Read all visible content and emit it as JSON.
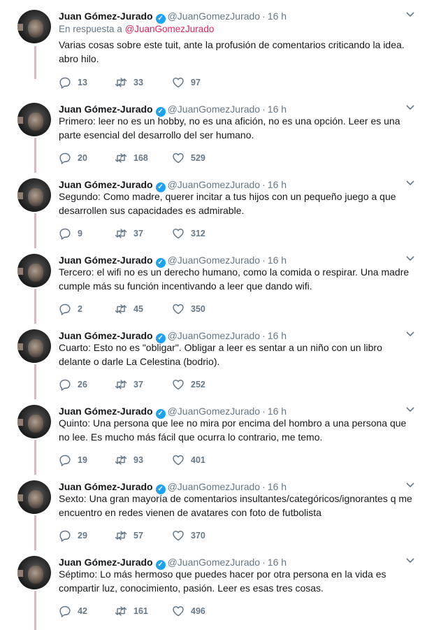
{
  "tweets": [
    {
      "name": "Juan Gómez-Jurado",
      "handle": "@JuanGomezJurado",
      "time": "16 h",
      "reply_prefix": "En respuesta a ",
      "reply_mention": "@JuanGomezJurado",
      "text": "Varias cosas sobre este tuit, ante la profusión de comentarios criticando la idea. abro hilo.",
      "replies": "13",
      "retweets": "33",
      "likes": "97"
    },
    {
      "name": "Juan Gómez-Jurado",
      "handle": "@JuanGomezJurado",
      "time": "16 h",
      "text": "Primero: leer no es un hobby, no es una afición, no es una opción. Leer es una parte esencial del desarrollo del ser humano.",
      "replies": "20",
      "retweets": "168",
      "likes": "529"
    },
    {
      "name": "Juan Gómez-Jurado",
      "handle": "@JuanGomezJurado",
      "time": "16 h",
      "text": "Segundo: Como madre, querer incitar a tus hijos con un pequeño juego a que desarrollen sus capacidades es admirable.",
      "replies": "9",
      "retweets": "37",
      "likes": "312"
    },
    {
      "name": "Juan Gómez-Jurado",
      "handle": "@JuanGomezJurado",
      "time": "16 h",
      "text": "Tercero: el wifi no es un derecho humano, como la comida o respirar. Una madre cumple más su función incentivando a leer que dando wifi.",
      "replies": "2",
      "retweets": "45",
      "likes": "350"
    },
    {
      "name": "Juan Gómez-Jurado",
      "handle": "@JuanGomezJurado",
      "time": "16 h",
      "text": "Cuarto: Esto no es \"obligar\". Obligar a leer es sentar a un niño con un libro delante o darle La Celestina (bodrio).",
      "replies": "26",
      "retweets": "37",
      "likes": "252"
    },
    {
      "name": "Juan Gómez-Jurado",
      "handle": "@JuanGomezJurado",
      "time": "16 h",
      "text": "Quinto: Una persona que lee no mira por encima del hombro a una persona que no lee. Es mucho más fácil que ocurra lo contrario, me temo.",
      "replies": "19",
      "retweets": "93",
      "likes": "401"
    },
    {
      "name": "Juan Gómez-Jurado",
      "handle": "@JuanGomezJurado",
      "time": "16 h",
      "text": "Sexto: Una gran mayoría de comentarios insultantes/categóricos/ignorantes q me encuentro en redes vienen de avatares con foto de futbolista",
      "replies": "29",
      "retweets": "57",
      "likes": "370"
    },
    {
      "name": "Juan Gómez-Jurado",
      "handle": "@JuanGomezJurado",
      "time": "16 h",
      "text": "Séptimo: Lo más hermoso que puedes hacer por otra persona en la vida es compartir luz, conocimiento, pasión. Leer es esas tres cosas.",
      "replies": "42",
      "retweets": "161",
      "likes": "496"
    }
  ],
  "colors": {
    "thread_line": "#e8b6c0",
    "verified": "#1da1f2",
    "mention": "#e0245e",
    "muted": "#657786"
  }
}
